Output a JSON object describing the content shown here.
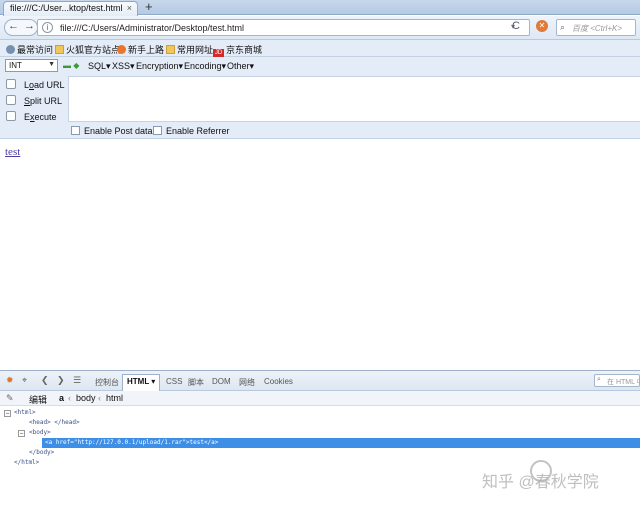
{
  "tab": {
    "title": "file:///C:/User...ktop/test.html",
    "close": "×",
    "new_tab": "+"
  },
  "nav": {
    "back": "←",
    "forward": "→",
    "url": "file:///C:/Users/Administrator/Desktop/test.html",
    "dropdown": "▾",
    "reload": "C",
    "stop": "✕",
    "search_placeholder": "百度 <Ctrl+K>",
    "info": "i"
  },
  "bookmarks": [
    {
      "label": "最常访问",
      "icon": "gear-icon"
    },
    {
      "label": "火狐官方站点",
      "icon": "folder-icon"
    },
    {
      "label": "新手上路",
      "icon": "firefox-icon"
    },
    {
      "label": "常用网址",
      "icon": "folder-icon"
    },
    {
      "label": "京东商城",
      "icon": "jd-icon",
      "icon_text": "JD"
    }
  ],
  "hackbar": {
    "select_value": "INT",
    "arrows": "▬ ◆",
    "menus": [
      "SQL▾",
      "XSS▾",
      "Encryption▾",
      "Encoding▾",
      "Other▾"
    ],
    "actions": [
      {
        "u": "o",
        "pre": "L",
        "post": "ad URL"
      },
      {
        "u": "S",
        "pre": "",
        "post": "plit URL"
      },
      {
        "u": "x",
        "pre": "E",
        "post": "ecute"
      }
    ],
    "checkbox_post": "Enable Post data",
    "checkbox_referrer": "Enable Referrer"
  },
  "content": {
    "link_text": "test"
  },
  "devtools": {
    "tabs": [
      "控制台",
      "CSS",
      "脚本",
      "DOM",
      "网络",
      "Cookies"
    ],
    "active_tab": "HTML ▾",
    "search_placeholder": "在 HTML 中搜索",
    "edit_label": "编辑",
    "breadcrumbs": [
      "a",
      "‹",
      "body",
      "‹",
      "html"
    ],
    "tree": [
      "<html>",
      "<head> </head>",
      "<body>",
      "<a  href=\"http://127.0.0.1/upload/1.rar\">test</a>",
      "</body>",
      "</html>"
    ]
  },
  "watermark": "知乎 @春秋学院"
}
